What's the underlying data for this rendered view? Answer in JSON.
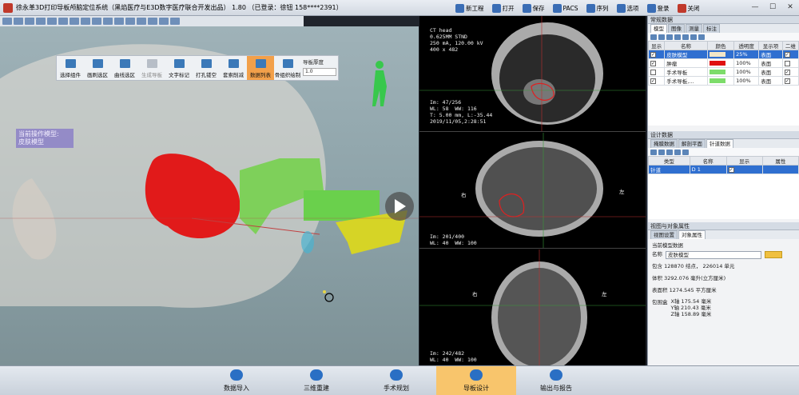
{
  "title": "徐永革3D打印导板颅脑定位系统（黑焰医疗与E3D数字医疗联合开发出品） 1.80 （已登录：徐钮 158****2391）",
  "topmenu": {
    "new_project": "新工程",
    "open": "打开",
    "save": "保存",
    "pacs": "PACS",
    "sequence": "序列",
    "options": "选项",
    "login": "登录",
    "close": "关闭"
  },
  "toolbar3d": {
    "select_component": "选择组件",
    "brush_select": "画刷选区",
    "curve_select": "曲线选区",
    "gen_guide": "生成导板",
    "text_mark": "文字标记",
    "punch_hollow": "打孔镂空",
    "cover_reduce": "套索削减",
    "data_list": "数据列表",
    "bone_draw": "骨组织绘制",
    "thickness_label": "导板厚度",
    "thickness_value": "1.0"
  },
  "current_model": {
    "title": "当前操作模型:",
    "name": "皮肤模型"
  },
  "ct": {
    "axial_info": "CT head\n0.625MM STND\n250 mA, 120.00 kV\n400 x 482",
    "axial_img": "Im: 47/256\nWL: 58  WW: 116\nT: 5.00 mm, L:-35.44\n2019/11/05,2:28:51",
    "coronal_img": "Im: 201/400\nWL: 40  WW: 100",
    "sagittal_img": "Im: 242/482\nWL: 40  WW: 100",
    "side_left": "右",
    "side_right": "左"
  },
  "right": {
    "section1_title": "常规数据",
    "tabs1": [
      "模型",
      "图像",
      "测量",
      "标注"
    ],
    "model_headers": [
      "显示",
      "名称",
      "颜色",
      "透明度",
      "显示项",
      "二维"
    ],
    "models": [
      {
        "name": "皮肤模型",
        "color": "#f3e7c8",
        "alpha": "25%",
        "mode": "表面",
        "show": "✓",
        "two": "✓",
        "selected": true
      },
      {
        "name": "肿瘤",
        "color": "#e01010",
        "alpha": "100%",
        "mode": "表面",
        "show": "✓",
        "two": "",
        "selected": false
      },
      {
        "name": "手术导板",
        "color": "#7ddc6a",
        "alpha": "100%",
        "mode": "表面",
        "show": "",
        "two": "✓",
        "selected": false
      },
      {
        "name": "手术导板,...",
        "color": "#7ddc6a",
        "alpha": "100%",
        "mode": "表面",
        "show": "✓",
        "two": "✓",
        "selected": false
      }
    ],
    "section2_title": "设计数据",
    "tabs2": [
      "掩膜数据",
      "解剖平面",
      "针道数据"
    ],
    "needle_headers": [
      "类型",
      "名称",
      "显示",
      "属性"
    ],
    "needle_rows": [
      {
        "type": "针道",
        "name": "D 1",
        "show": "✓",
        "attr": ""
      }
    ],
    "section3_title": "视图与对象属性",
    "tabs3": [
      "视图设置",
      "对象属性"
    ],
    "attr_title": "当前模型数据",
    "attr_name_label": "名称",
    "attr_name_value": "皮肤模型",
    "contains": "包含 128870 结点， 226014 单元",
    "volume": "体积  3292.076 毫升(立方厘米)",
    "area": "表面积  1274.545 平方厘米",
    "bbox_label": "包围盒",
    "bbox_x": "X轴  175.54 毫米",
    "bbox_y": "Y轴  210.43 毫米",
    "bbox_z": "Z轴  158.89 毫米"
  },
  "taskbar": [
    "数据导入",
    "三维重建",
    "手术规划",
    "导板设计",
    "输出与报告"
  ]
}
